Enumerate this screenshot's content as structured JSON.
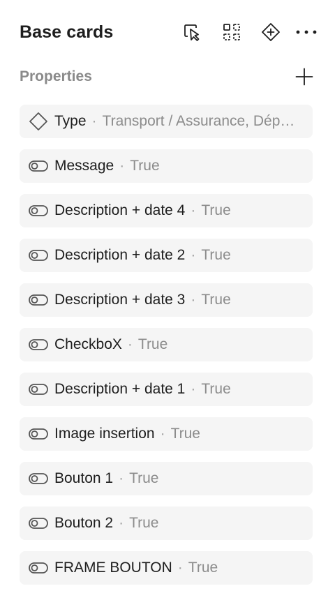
{
  "header": {
    "title": "Base cards",
    "icons": [
      "select-matching-layers-icon",
      "component-grid-icon",
      "component-icon",
      "more-icon"
    ]
  },
  "section": {
    "label": "Properties",
    "add_icon": "plus-icon"
  },
  "properties": [
    {
      "name": "Type",
      "value": "Transport / Assurance, Dépenses…",
      "kind": "variant"
    },
    {
      "name": "Message",
      "value": "True",
      "kind": "boolean"
    },
    {
      "name": "Description + date 4",
      "value": "True",
      "kind": "boolean"
    },
    {
      "name": "Description + date 2",
      "value": "True",
      "kind": "boolean"
    },
    {
      "name": "Description + date 3",
      "value": "True",
      "kind": "boolean"
    },
    {
      "name": "CheckboX",
      "value": "True",
      "kind": "boolean"
    },
    {
      "name": "Description + date 1",
      "value": "True",
      "kind": "boolean"
    },
    {
      "name": "Image insertion",
      "value": "True",
      "kind": "boolean"
    },
    {
      "name": "Bouton 1",
      "value": "True",
      "kind": "boolean"
    },
    {
      "name": "Bouton 2",
      "value": "True",
      "kind": "boolean"
    },
    {
      "name": "FRAME BOUTON",
      "value": "True",
      "kind": "boolean"
    }
  ],
  "colors": {
    "text": "#1e1e1e",
    "muted": "#8c8c8c",
    "row_bg": "#f5f5f5"
  }
}
